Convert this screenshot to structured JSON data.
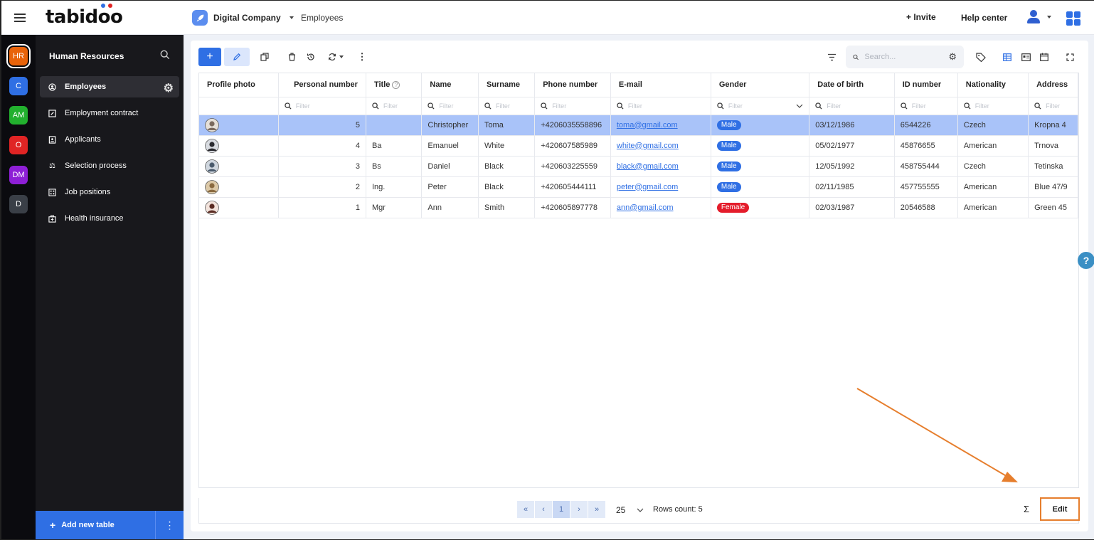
{
  "app": {
    "logo": "tabidoo"
  },
  "header": {
    "project_name": "Digital Company",
    "breadcrumb": "Employees",
    "invite_label": "+ Invite",
    "help_label": "Help center"
  },
  "workspaces": [
    {
      "label": "HR",
      "color": "#e8630a",
      "selected": true
    },
    {
      "label": "C",
      "color": "#2f6fe4"
    },
    {
      "label": "AM",
      "color": "#22b02e"
    },
    {
      "label": "O",
      "color": "#e02424"
    },
    {
      "label": "DM",
      "color": "#8e1fd6"
    },
    {
      "label": "D",
      "color": "#3a3f47"
    }
  ],
  "sidebar": {
    "title": "Human Resources",
    "items": [
      {
        "label": "Employees",
        "icon": "person-circle-icon",
        "active": true
      },
      {
        "label": "Employment contract",
        "icon": "edit-square-icon"
      },
      {
        "label": "Applicants",
        "icon": "contact-card-icon"
      },
      {
        "label": "Selection process",
        "icon": "scales-icon"
      },
      {
        "label": "Job positions",
        "icon": "grid-dots-icon"
      },
      {
        "label": "Health insurance",
        "icon": "medical-case-icon"
      }
    ],
    "add_table_label": "Add new table"
  },
  "toolbar": {
    "search_placeholder": "Search..."
  },
  "table": {
    "columns": [
      "Profile photo",
      "Personal number",
      "Title",
      "Name",
      "Surname",
      "Phone number",
      "E-mail",
      "Gender",
      "Date of birth",
      "ID number",
      "Nationality",
      "Address"
    ],
    "filter_placeholder": "Filter",
    "rows": [
      {
        "number": "5",
        "title": "",
        "name": "Christopher",
        "surname": "Toma",
        "phone": "+4206035558896",
        "email": "toma@gmail.com",
        "gender": "Male",
        "dob": "03/12/1986",
        "id": "6544226",
        "nationality": "Czech",
        "address": "Kropna 4",
        "selected": true
      },
      {
        "number": "4",
        "title": "Ba",
        "name": "Emanuel",
        "surname": "White",
        "phone": "+420607585989",
        "email": "white@gmail.com",
        "gender": "Male",
        "dob": "05/02/1977",
        "id": "45876655",
        "nationality": "American",
        "address": "Trnova"
      },
      {
        "number": "3",
        "title": "Bs",
        "name": "Daniel",
        "surname": "Black",
        "phone": "+420603225559",
        "email": "black@gmail.com",
        "gender": "Male",
        "dob": "12/05/1992",
        "id": "458755444",
        "nationality": "Czech",
        "address": "Tetinska"
      },
      {
        "number": "2",
        "title": "Ing.",
        "name": "Peter",
        "surname": "Black",
        "phone": "+420605444111",
        "email": "peter@gmail.com",
        "gender": "Male",
        "dob": "02/11/1985",
        "id": "457755555",
        "nationality": "American",
        "address": "Blue 47/9"
      },
      {
        "number": "1",
        "title": "Mgr",
        "name": "Ann",
        "surname": "Smith",
        "phone": "+420605897778",
        "email": "ann@gmail.com",
        "gender": "Female",
        "dob": "02/03/1987",
        "id": "20546588",
        "nationality": "American",
        "address": "Green 45"
      }
    ]
  },
  "colors": {
    "male": "#2f6fe4",
    "female": "#e41c2b",
    "accent": "#2f6fe4",
    "highlight": "#e67e2d"
  },
  "pagination": {
    "current_page": "1",
    "page_size": "25",
    "rows_count": "Rows count: 5",
    "sum_symbol": "Σ",
    "edit_label": "Edit"
  }
}
